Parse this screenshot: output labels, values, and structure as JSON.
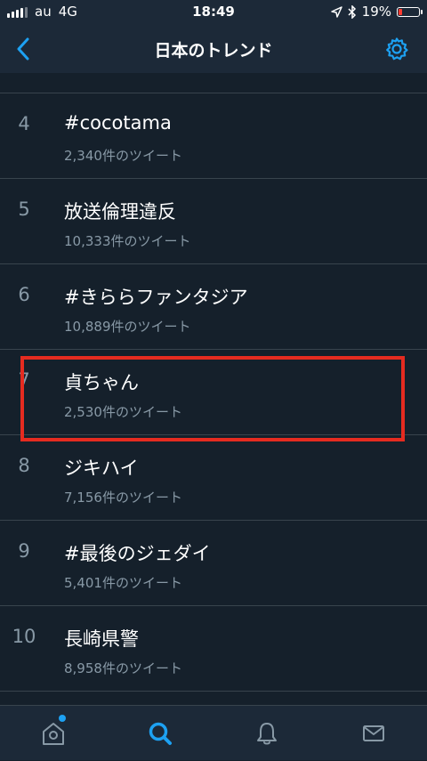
{
  "status_bar": {
    "carrier": "au",
    "network": "4G",
    "time": "18:49",
    "battery_percent": "19%",
    "battery_level": 0.19,
    "battery_color": "#ff3b30"
  },
  "nav": {
    "title": "日本のトレンド",
    "accent_color": "#1da1f2"
  },
  "trends": [
    {
      "rank": "4",
      "name": "#cocotama",
      "count": "2,340件のツイート"
    },
    {
      "rank": "5",
      "name": "放送倫理違反",
      "count": "10,333件のツイート"
    },
    {
      "rank": "6",
      "name": "#きららファンタジア",
      "count": "10,889件のツイート"
    },
    {
      "rank": "7",
      "name": "貞ちゃん",
      "count": "2,530件のツイート"
    },
    {
      "rank": "8",
      "name": "ジキハイ",
      "count": "7,156件のツイート"
    },
    {
      "rank": "9",
      "name": "#最後のジェダイ",
      "count": "5,401件のツイート"
    },
    {
      "rank": "10",
      "name": "長崎県警",
      "count": "8,958件のツイート"
    }
  ],
  "highlight": {
    "color": "#e52b20",
    "trend_rank": "7"
  },
  "tab_bar": {
    "tabs": [
      {
        "icon": "home-icon",
        "active": false,
        "has_badge": true
      },
      {
        "icon": "search-icon",
        "active": true,
        "has_badge": false
      },
      {
        "icon": "bell-icon",
        "active": false,
        "has_badge": false
      },
      {
        "icon": "mail-icon",
        "active": false,
        "has_badge": false
      }
    ]
  }
}
